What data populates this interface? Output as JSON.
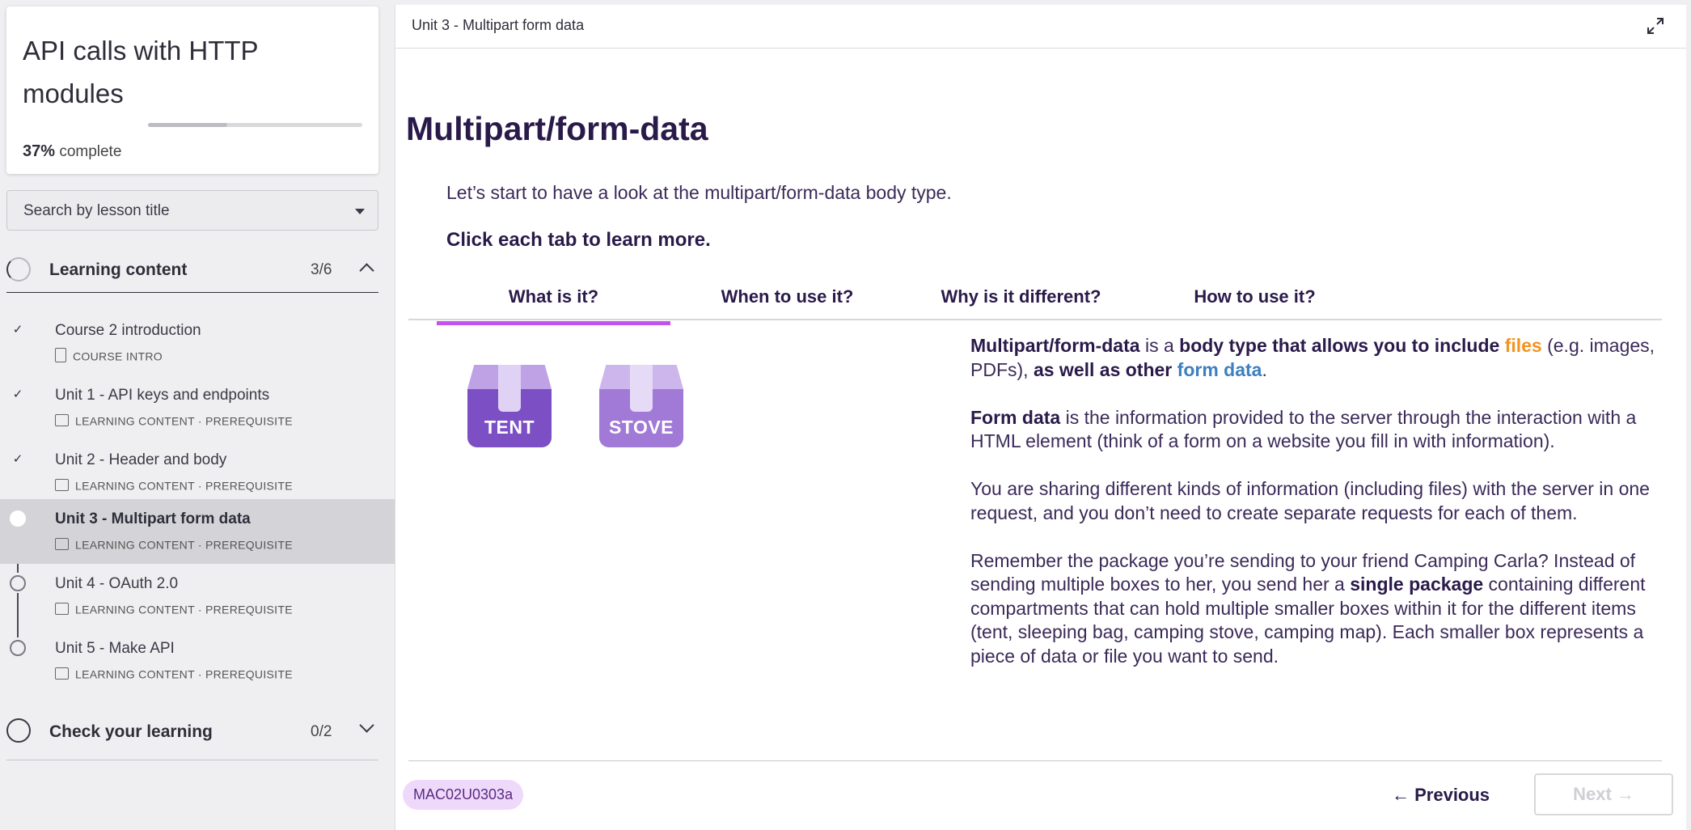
{
  "sidebar": {
    "course_title": "API calls with HTTP modules",
    "progress_percent": "37%",
    "progress_label": "complete",
    "progress_fraction": 0.37,
    "search": {
      "placeholder": "Search by lesson title"
    },
    "sections": [
      {
        "title": "Learning content",
        "count": "3/6",
        "expanded": true
      },
      {
        "title": "Check your learning",
        "count": "0/2",
        "expanded": false
      }
    ],
    "lessons": [
      {
        "title": "Course 2 introduction",
        "meta": "COURSE INTRO",
        "status": "done"
      },
      {
        "title": "Unit 1 - API keys and endpoints",
        "meta": "LEARNING CONTENT · PREREQUISITE",
        "status": "done"
      },
      {
        "title": "Unit 2 - Header and body",
        "meta": "LEARNING CONTENT · PREREQUISITE",
        "status": "done"
      },
      {
        "title": "Unit 3 - Multipart form data",
        "meta": "LEARNING CONTENT · PREREQUISITE",
        "status": "current"
      },
      {
        "title": "Unit 4 - OAuth 2.0",
        "meta": "LEARNING CONTENT · PREREQUISITE",
        "status": "todo"
      },
      {
        "title": "Unit 5 - Make API",
        "meta": "LEARNING CONTENT · PREREQUISITE",
        "status": "todo"
      }
    ]
  },
  "main": {
    "topbar_title": "Unit 3 - Multipart form data",
    "page_title": "Multipart/form-data",
    "intro": "Let’s start to have a look at the multipart/form-data body type.",
    "instruction": "Click each tab to learn more.",
    "tabs": [
      {
        "label": "What is it?",
        "active": true
      },
      {
        "label": "When to use it?",
        "active": false
      },
      {
        "label": "Why is it different?",
        "active": false
      },
      {
        "label": "How to use it?",
        "active": false
      }
    ],
    "boxes": [
      {
        "label": "TENT",
        "color": "#7c4fc4"
      },
      {
        "label": "STOVE",
        "color": "#a07ad6"
      }
    ],
    "content": {
      "p1": {
        "a": "Multipart/form-data",
        "b": " is a ",
        "c": "body type that allows you to include",
        "d": " ",
        "e": "files",
        "f": " (e.g. images, PDFs), ",
        "g": "as well as other",
        "h": " ",
        "i": "form data",
        "j": "."
      },
      "p2": {
        "a": "Form data",
        "b": " is the information provided to the server through the interaction with a HTML element (think of a form on a website you fill in with information)."
      },
      "p3": "You are sharing different kinds of information (including files) with the server in one request, and you don’t need to create separate requests for each of them.",
      "p4": {
        "a": "Remember the package you’re sending to your friend Camping Carla? Instead of sending multiple boxes to her, you send her a ",
        "b": "single package",
        "c": " containing different compartments that can hold multiple smaller boxes within it for the different items (tent, sleeping bag, camping stove, camping map). Each smaller box represents a piece of data or file you want to send."
      }
    },
    "code_badge": "MAC02U0303a",
    "prev_label": "← Previous",
    "next_label": "Next →"
  },
  "colors": {
    "accent_tab": "#c452f0",
    "heading": "#2a1a4a",
    "files_orange": "#f29322",
    "formdata_blue": "#3d7fbf",
    "badge_bg": "#efd9fb"
  }
}
